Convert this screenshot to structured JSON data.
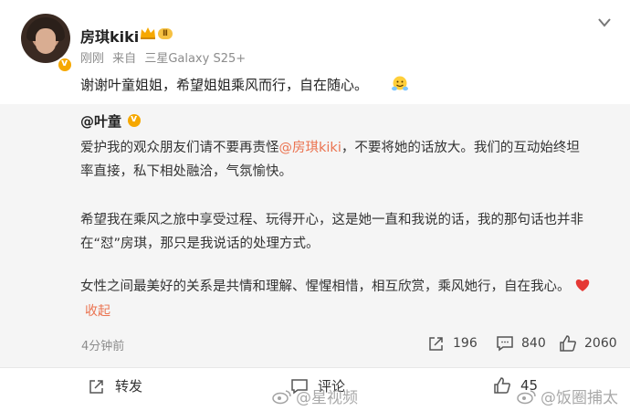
{
  "post": {
    "username": "房琪kiki",
    "level": "Ⅱ",
    "meta": {
      "time": "刚刚",
      "source_prefix": "来自",
      "device": "三星Galaxy S25+"
    },
    "text": "谢谢叶童姐姐，希望姐姐乘风而行，自在随心。"
  },
  "repost": {
    "author": "@叶童",
    "p1_a": "爱护我的观众朋友们请不要再责怪",
    "p1_mention": "@房琪kiki",
    "p1_b": "，不要将她的话放大。我们的互动始终坦",
    "p1_line2": "率直接，私下相处融洽，气氛愉快。",
    "p2_line1": "希望我在乘风之旅中享受过程、玩得开心，这是她一直和我说的话，我的那句话也并非",
    "p2_line2": "在“怼”房琪，那只是我说话的处理方式。",
    "p3": "女性之间最美好的关系是共情和理解、惺惺相惜，相互欣赏，乘风她行，自在我心。",
    "collapse_label": "收起",
    "time_ago": "4分钟前",
    "reposts": "196",
    "comments": "840",
    "likes": "2060"
  },
  "actions": {
    "repost_label": "转发",
    "comment_label": "评论",
    "like_label": "45"
  },
  "watermarks": [
    "@星视频",
    "@饭圈捕太"
  ],
  "colors": {
    "mention": "#eb7350",
    "repost_bg": "#f5f5f5",
    "verified": "#f6a800"
  }
}
